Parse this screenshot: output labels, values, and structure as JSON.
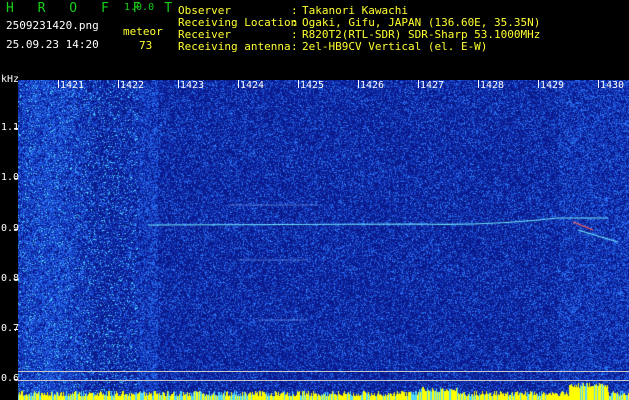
{
  "header": {
    "app_name": "H R O F F T",
    "version": "1.0.0",
    "file_name": "2509231420.png",
    "datetime": "25.09.23 14:20",
    "meteor_label": "meteor",
    "meteor_count": "73",
    "info": [
      {
        "label": "Observer",
        "value": "Takanori Kawachi"
      },
      {
        "label": "Receiving Location",
        "value": "Ogaki, Gifu, JAPAN (136.60E, 35.35N)"
      },
      {
        "label": "Receiver",
        "value": "R820T2(RTL-SDR) SDR-Sharp 53.1000MHz"
      },
      {
        "label": "Receiving antenna",
        "value": "2el-HB9CV Vertical (el. E-W)"
      }
    ],
    "separator": ":"
  },
  "spectrogram": {
    "y_unit": "kHz",
    "y_ticks": [
      "1.1",
      "1.0",
      "0.9",
      "0.8",
      "0.7",
      "0.6"
    ],
    "x_ticks": [
      "1421",
      "1422",
      "1423",
      "1424",
      "1425",
      "1426",
      "1427",
      "1428",
      "1429",
      "1430"
    ],
    "colors": {
      "background": "#0a1a8c",
      "noise": "#2a5cf0",
      "signal": "#70e8ff",
      "baseline": "#ffff00"
    }
  }
}
